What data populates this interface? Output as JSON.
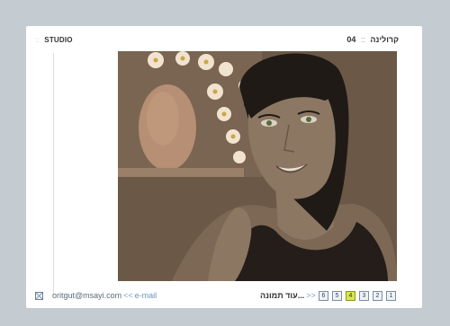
{
  "header": {
    "brand": "STUDIO",
    "brand_separator": "::",
    "title": "קרולינה",
    "number": "04",
    "title_separator": "::"
  },
  "artwork": {
    "colors": {
      "background": "#6b5847",
      "skin": "#8c7762",
      "hair": "#1f1a16",
      "top": "#241d19",
      "vase": "#b68f74",
      "flowers": "#f1e3cf"
    }
  },
  "footer": {
    "email": "oritgut@msayi.com",
    "email_arrows": "<<",
    "email_link": "e-mail",
    "more_label": "עוד תמונה...",
    "more_arrows": ">>",
    "pages": [
      "6",
      "5",
      "4",
      "3",
      "2",
      "1"
    ],
    "active_page": "4",
    "mail_icon": "envelope-icon"
  }
}
